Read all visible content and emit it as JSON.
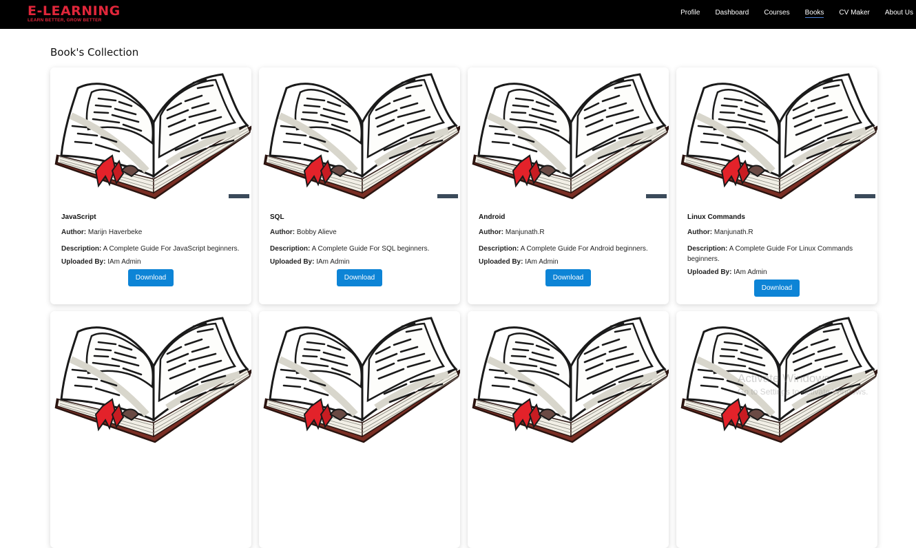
{
  "brand": {
    "title": "E-LEARNING",
    "tagline": "LEARN BETTER, GROW BETTER"
  },
  "nav": {
    "items": [
      {
        "label": "Profile",
        "active": false
      },
      {
        "label": "Dashboard",
        "active": false
      },
      {
        "label": "Courses",
        "active": false
      },
      {
        "label": "Books",
        "active": true
      },
      {
        "label": "CV Maker",
        "active": false
      },
      {
        "label": "About Us",
        "active": false
      }
    ]
  },
  "page": {
    "title": "Book's Collection"
  },
  "labels": {
    "author": "Author:",
    "description": "Description:",
    "uploaded_by": "Uploaded By:",
    "download": "Download"
  },
  "books": [
    {
      "title": "JavaScript",
      "author": "Marijn Haverbeke",
      "description": "A Complete Guide For JavaScript beginners.",
      "uploaded_by": "IAm Admin"
    },
    {
      "title": "SQL",
      "author": "Bobby Alieve",
      "description": "A Complete Guide For SQL beginners.",
      "uploaded_by": "IAm Admin"
    },
    {
      "title": "Android",
      "author": "Manjunath.R",
      "description": "A Complete Guide For Android beginners.",
      "uploaded_by": "IAm Admin"
    },
    {
      "title": "Linux Commands",
      "author": "Manjunath.R",
      "description": "A Complete Guide For Linux Commands beginners.",
      "uploaded_by": "IAm Admin"
    },
    {
      "title": "",
      "author": "",
      "description": "",
      "uploaded_by": ""
    },
    {
      "title": "",
      "author": "",
      "description": "",
      "uploaded_by": ""
    },
    {
      "title": "",
      "author": "",
      "description": "",
      "uploaded_by": ""
    },
    {
      "title": "",
      "author": "",
      "description": "",
      "uploaded_by": ""
    }
  ],
  "watermark": {
    "title": "Activate Windows",
    "subtitle": "Go to Settings to activate Windows."
  },
  "colors": {
    "brand": "#e0263a",
    "topbar": "#000000",
    "button": "#0d84d6",
    "bookmark": "#e3222a",
    "book_cover": "#7a2e24"
  },
  "icons": {
    "book_image": "open-book-illustration"
  }
}
